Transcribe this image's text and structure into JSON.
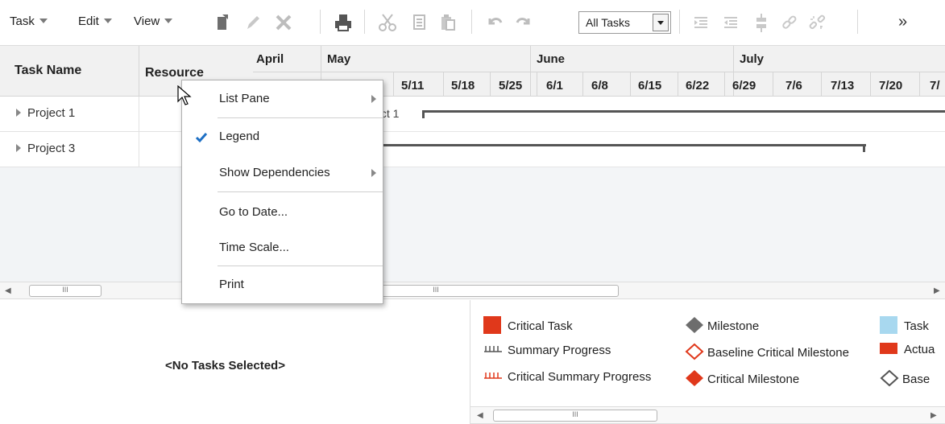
{
  "toolbar": {
    "menus": [
      {
        "label": "Task"
      },
      {
        "label": "Edit"
      },
      {
        "label": "View"
      }
    ],
    "filter_value": "All Tasks",
    "overflow_glyph": "»",
    "icons": [
      "new-task-icon",
      "edit-pencil-icon",
      "delete-x-icon",
      "print-icon",
      "cut-icon",
      "copy-icon",
      "paste-icon",
      "undo-icon",
      "redo-icon",
      "indent-icon",
      "outdent-icon",
      "split-icon",
      "link-icon",
      "unlink-icon"
    ]
  },
  "table": {
    "col_task_name": "Task Name",
    "col_resource": "Resource",
    "rows": [
      {
        "name": "Project 1"
      },
      {
        "name": "Project 3"
      }
    ]
  },
  "gantt": {
    "months": [
      "April",
      "May",
      "June",
      "July"
    ],
    "weeks": [
      "5/11",
      "5/18",
      "5/25",
      "6/1",
      "6/8",
      "6/15",
      "6/22",
      "6/29",
      "7/6",
      "7/13",
      "7/20",
      "7/"
    ],
    "bar_label": "ject 1"
  },
  "scroll_thumb_glyph": "III",
  "detail": {
    "empty_text": "<No Tasks Selected>"
  },
  "legend": {
    "items": [
      {
        "label": "Critical Task",
        "color": "#e0381b"
      },
      {
        "label": "Summary Progress",
        "color": "#555555"
      },
      {
        "label": "Critical Summary Progress",
        "color": "#e0381b"
      },
      {
        "label": "Milestone",
        "color": "#6d6d6d"
      },
      {
        "label": "Baseline Critical Milestone",
        "color": "#e0381b"
      },
      {
        "label": "Critical Milestone",
        "color": "#e0381b"
      },
      {
        "label": "Task",
        "color": "#a8d8ef"
      },
      {
        "label": "Actua",
        "color": "#e0381b"
      },
      {
        "label": "Base",
        "color": "#555555"
      }
    ]
  },
  "context_menu": {
    "items": [
      {
        "label": "List Pane",
        "submenu": true,
        "checked": false
      },
      {
        "label": "Legend",
        "submenu": false,
        "checked": true
      },
      {
        "label": "Show Dependencies",
        "submenu": true,
        "checked": false
      },
      {
        "label": "Go to Date...",
        "submenu": false,
        "checked": false
      },
      {
        "label": "Time Scale...",
        "submenu": false,
        "checked": false
      },
      {
        "label": "Print",
        "submenu": false,
        "checked": false
      }
    ]
  },
  "colors": {
    "critical": "#e0381b",
    "check": "#1d6fc4",
    "task": "#a8d8ef"
  }
}
